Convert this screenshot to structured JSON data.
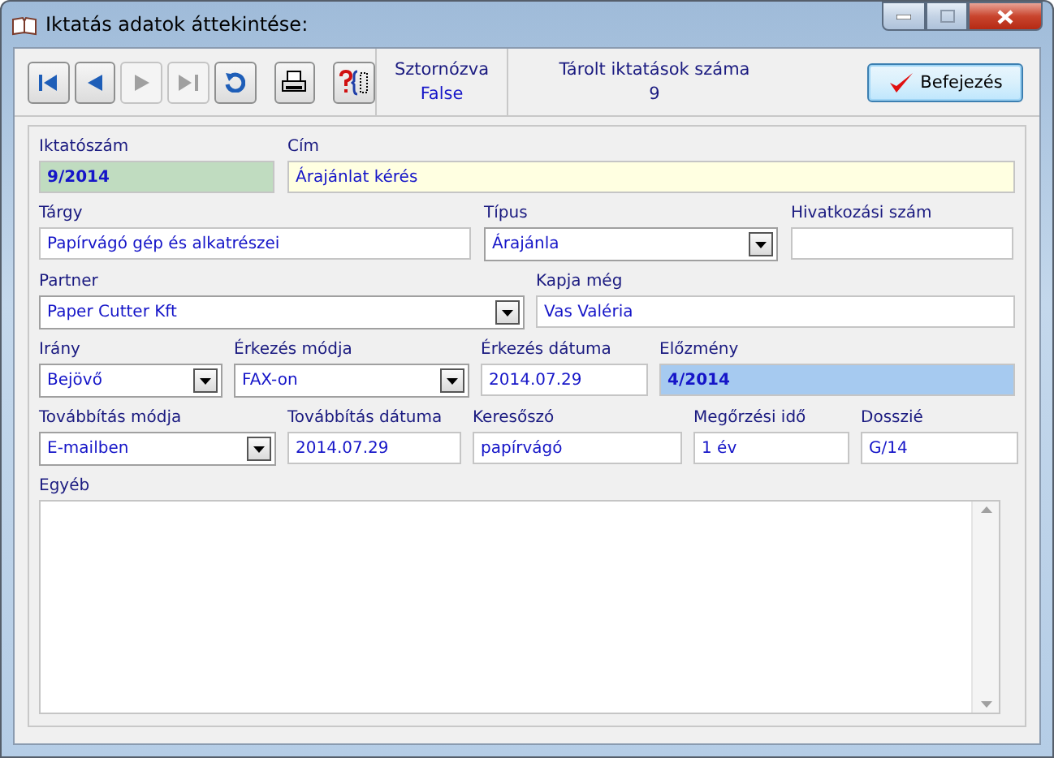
{
  "window": {
    "title": "Iktatás adatok áttekintése:"
  },
  "toolbar": {
    "nav_buttons": [
      {
        "kind": "first",
        "disabled": false
      },
      {
        "kind": "prev",
        "disabled": false
      },
      {
        "kind": "next",
        "disabled": true
      },
      {
        "kind": "last",
        "disabled": true
      },
      {
        "kind": "refresh",
        "disabled": false
      },
      {
        "kind": "print",
        "disabled": false
      },
      {
        "kind": "query",
        "disabled": false
      }
    ],
    "status": [
      {
        "label": "Sztornózva",
        "value": "False"
      },
      {
        "label": "Tárolt iktatások száma",
        "value": "9"
      }
    ],
    "finish_button": "Befejezés"
  },
  "form": {
    "fields": [
      {
        "label": "Iktatószám",
        "value": "9/2014",
        "kind": "number",
        "color": "#c0dcc0"
      },
      {
        "label": "Cím",
        "value": "Árajánlat kérés",
        "kind": "text",
        "color": "#ffffe1"
      },
      {
        "label": "Tárgy",
        "value": "Papírvágó gép és alkatrészei",
        "kind": "text"
      },
      {
        "label": "Típus",
        "value": "Árajánla",
        "kind": "combo"
      },
      {
        "label": "Hivatkozási szám",
        "kind": "text"
      },
      {
        "label": "Partner",
        "value": "Paper Cutter Kft",
        "kind": "combo"
      },
      {
        "label": "Kapja még",
        "value": "Vas Valéria",
        "kind": "text"
      },
      {
        "label": "Irány",
        "value": "Bejövő",
        "kind": "combo"
      },
      {
        "label": "Érkezés módja",
        "value": "FAX-on",
        "kind": "combo"
      },
      {
        "label": "Érkezés dátuma",
        "value": "2014.07.29",
        "kind": "text"
      },
      {
        "label": "Előzmény",
        "value": "4/2014",
        "kind": "number",
        "color": "#a6caf0"
      },
      {
        "label": "Továbbítás módja",
        "value": "E-mailben",
        "kind": "combo"
      },
      {
        "label": "Továbbítás dátuma",
        "value": "2014.07.29",
        "kind": "text"
      },
      {
        "label": "Keresőszó",
        "value": "papírvágó",
        "kind": "text"
      },
      {
        "label": "Megőrzési idő",
        "value": "1 év",
        "kind": "text"
      },
      {
        "label": "Dosszié",
        "value": "G/14",
        "kind": "text"
      },
      {
        "label": "Egyéb",
        "kind": "memo"
      }
    ]
  }
}
